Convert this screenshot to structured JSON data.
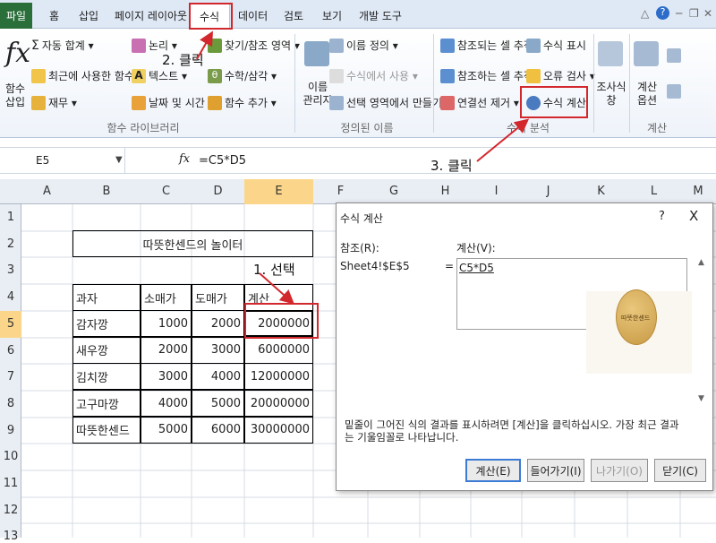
{
  "tabs": {
    "file": "파일",
    "home": "홈",
    "insert": "삽입",
    "page_layout": "페이지 레이아웃",
    "formulas": "수식",
    "data": "데이터",
    "review": "검토",
    "view": "보기",
    "developer": "개발 도구"
  },
  "ribbon": {
    "insert_function": "함수\n삽입",
    "autosum": "자동 합계",
    "recent": "최근에 사용한 함수",
    "financial": "재무",
    "logical": "논리",
    "text": "텍스트",
    "datetime": "날짜 및 시간",
    "lookup": "찾기/참조 영역",
    "math": "수학/삼각",
    "more": "함수 추가",
    "group_library": "함수 라이브러리",
    "name_manager": "이름\n관리자",
    "define_name": "이름 정의",
    "use_in_formula": "수식에서 사용",
    "create_from_selection": "선택 영역에서 만들기",
    "group_names": "정의된 이름",
    "trace_precedents": "참조되는 셀 추적",
    "trace_dependents": "참조하는 셀 추적",
    "remove_arrows": "연결선 제거",
    "show_formulas": "수식 표시",
    "error_checking": "오류 검사",
    "evaluate_formula": "수식 계산",
    "group_auditing": "수식 분석",
    "watch_window": "조사식\n창",
    "calc_options": "계산\n옵션",
    "group_calc": "계산"
  },
  "formula_bar": {
    "name_box": "E5",
    "formula": "=C5*D5"
  },
  "columns": [
    "A",
    "B",
    "C",
    "D",
    "E",
    "F",
    "G",
    "H",
    "I",
    "J",
    "K",
    "L",
    "M"
  ],
  "rows": [
    "1",
    "2",
    "3",
    "4",
    "5",
    "6",
    "7",
    "8",
    "9",
    "10",
    "11",
    "12",
    "13"
  ],
  "sheet": {
    "title": "따뜻한센드의 놀이터",
    "headers": [
      "과자",
      "소매가",
      "도매가",
      "계산"
    ],
    "data": [
      [
        "감자깡",
        "1000",
        "2000",
        "2000000"
      ],
      [
        "새우깡",
        "2000",
        "3000",
        "6000000"
      ],
      [
        "김치깡",
        "3000",
        "4000",
        "12000000"
      ],
      [
        "고구마깡",
        "4000",
        "5000",
        "20000000"
      ],
      [
        "따뜻한센드",
        "5000",
        "6000",
        "30000000"
      ]
    ]
  },
  "dialog": {
    "title": "수식 계산",
    "help": "?",
    "close": "X",
    "reference_label": "참조(R):",
    "reference_value": "Sheet4!$E$5",
    "equals": "=",
    "evaluation_label": "계산(V):",
    "evaluation_value": "C5*D5",
    "info": "밑줄이 그어진 식의 결과를 표시하려면 [계산]을 클릭하십시오. 가장 최근 결과는 기울임꼴로 나타납니다.",
    "btn_evaluate": "계산(E)",
    "btn_step_in": "들어가기(I)",
    "btn_step_out": "나가기(O)",
    "btn_close": "닫기(C)",
    "watermark": "따뜻한센드"
  },
  "annotations": {
    "step1": "1. 선택",
    "step2": "2. 클릭",
    "step3": "3. 클릭"
  },
  "colors": {
    "highlight": "#d2272c",
    "file_tab": "#2a6f3a",
    "selected_col": "#fbd68a"
  }
}
